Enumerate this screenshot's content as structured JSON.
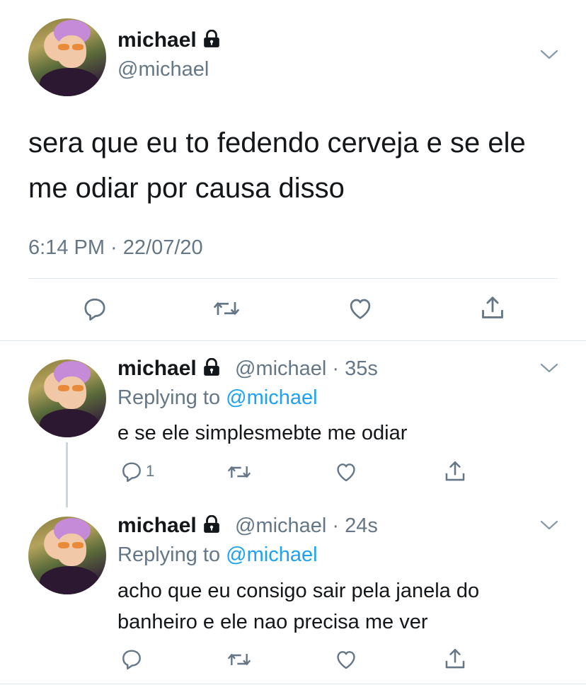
{
  "main_tweet": {
    "name": "michael",
    "handle": "@michael",
    "text": "sera que eu to fedendo cerveja e se ele me odiar por causa disso",
    "timestamp": "6:14 PM · 22/07/20",
    "actions": {
      "reply_icon": "reply-icon",
      "retweet_icon": "retweet-icon",
      "like_icon": "heart-icon",
      "share_icon": "share-icon"
    }
  },
  "replies": [
    {
      "name": "michael",
      "handle": "@michael",
      "time": "35s",
      "replying_label": "Replying to",
      "replying_to": "@michael",
      "text": "e se ele simplesmebte me odiar",
      "reply_count": "1"
    },
    {
      "name": "michael",
      "handle": "@michael",
      "time": "24s",
      "replying_label": "Replying to",
      "replying_to": "@michael",
      "text": "acho que eu consigo sair pela janela do banheiro e ele nao precisa me ver",
      "reply_count": ""
    }
  ],
  "colors": {
    "accent": "#1da1f2",
    "secondary_text": "#657786",
    "divider": "#e1e8ed"
  }
}
